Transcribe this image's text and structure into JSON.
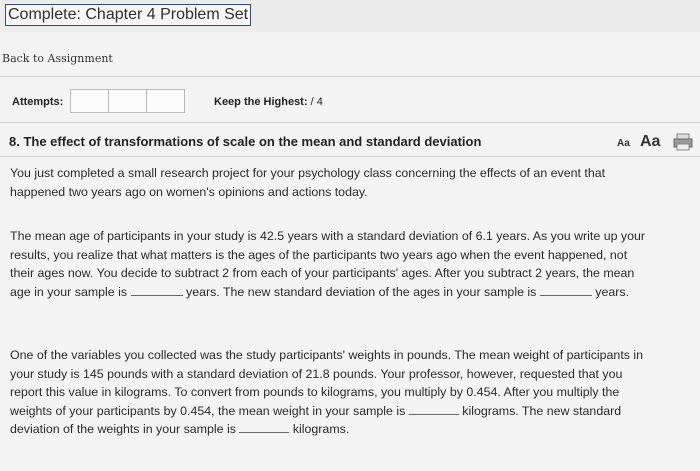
{
  "header": {
    "title": "Complete: Chapter 4 Problem Set"
  },
  "nav": {
    "back_label": "Back to Assignment"
  },
  "attempts": {
    "label": "Attempts:",
    "keep_label": "Keep the Highest:",
    "keep_value": "/ 4"
  },
  "question": {
    "title": "8. The effect of transformations of scale on the mean and standard deviation",
    "font_small": "Aa",
    "font_large": "Aa",
    "intro_line1": "You just completed a small research project for your psychology class concerning the effects of an event that",
    "intro_line2": "happened two years ago on women's opinions and actions today.",
    "p2_line1": "The mean age of participants in your study is 42.5 years with a standard deviation of 6.1 years. As you write up your",
    "p2_line2": "results, you realize that what matters is the ages of the participants two years ago when the event happened, not",
    "p2_line3": "their ages now. You decide to subtract 2 from each of your participants' ages. After you subtract 2 years, the mean",
    "p2_line4_a": "age in your sample is",
    "p2_line4_b": "years. The new standard deviation of the ages in your sample is",
    "p2_line4_c": "years.",
    "p3_line1": "One of the variables you collected was the study participants' weights in pounds. The mean weight of participants in",
    "p3_line2": "your study is 145 pounds with a standard deviation of 21.8 pounds. Your professor, however, requested that you",
    "p3_line3": "report this value in kilograms. To convert from pounds to kilograms, you multiply by 0.454. After you multiply the",
    "p3_line4_a": "weights of your participants by 0.454, the mean weight in your sample is",
    "p3_line4_b": "kilograms. The new standard",
    "p3_line5_a": "deviation of the weights in your sample is",
    "p3_line5_b": "kilograms."
  }
}
